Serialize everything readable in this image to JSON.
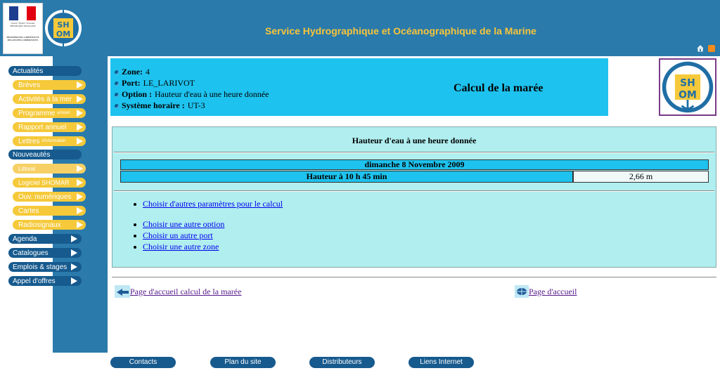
{
  "header": {
    "republique_label": "Liberté • Égalité • Fraternité RÉPUBLIQUE FRANÇAISE",
    "ministry_label": "MINISTÈRE DE LA DÉFENSE ET DES ANCIENS COMBATTANTS",
    "logo_text_top": "SH",
    "logo_text_bottom": "OM",
    "title": "Service Hydrographique et Océanographique de la Marine"
  },
  "nav": {
    "items": [
      {
        "label": "Actualités",
        "type": "main"
      },
      {
        "label": "Brèves",
        "type": "sub"
      },
      {
        "label": "Activités à la mer",
        "type": "sub"
      },
      {
        "label": "Programme",
        "suffix": "annuel",
        "type": "sub"
      },
      {
        "label": "Rapport annuel",
        "type": "sub"
      },
      {
        "label": "Lettres",
        "suffix": "d'information",
        "type": "sub"
      },
      {
        "label": "Nouveautés",
        "type": "main"
      },
      {
        "label": "Littoral",
        "type": "sub"
      },
      {
        "label": "Logiciel SHOMAR",
        "type": "sub"
      },
      {
        "label": "Ouv. numériques",
        "type": "sub"
      },
      {
        "label": "Cartes",
        "type": "sub"
      },
      {
        "label": "Radiosignaux",
        "type": "sub"
      },
      {
        "label": "Agenda",
        "type": "main"
      },
      {
        "label": "Catalogues",
        "type": "main"
      },
      {
        "label": "Emplois & stages",
        "type": "main"
      },
      {
        "label": "Appel d'offres",
        "type": "main"
      }
    ]
  },
  "info": {
    "zone_label": "Zone:",
    "zone_value": "4",
    "port_label": "Port:",
    "port_value": "LE_LARIVOT",
    "option_label": "Option :",
    "option_value": "Hauteur d'eau à une heure donnée",
    "system_label": "Système horaire :",
    "system_value": "UT-3",
    "page_title": "Calcul de la marée"
  },
  "result": {
    "title": "Hauteur d'eau à une heure donnée",
    "date": "dimanche 8 Novembre 2009",
    "height_label": "Hauteur à 10 h 45 min",
    "height_value": "2,66 m",
    "links": [
      "Choisir d'autres paramètres pour le calcul",
      "Choisir une autre option",
      "Choisir un autre port",
      "Choisir une autre zone"
    ]
  },
  "bottom_links": {
    "tide_home": "Page d'accueil calcul de la marée",
    "home": "Page d'accueil"
  },
  "footer": {
    "buttons": [
      "Contacts",
      "Plan du site",
      "Distributeurs",
      "Liens Internet"
    ]
  },
  "colors": {
    "header_blue": "#2a7aab",
    "nav_dark": "#165a8e",
    "nav_yellow": "#f5c93a",
    "panel_cyan": "#1ec2ee",
    "result_bg": "#b0eeef",
    "title_gold": "#f7c53a"
  },
  "icons": [
    "home-icon",
    "rss-icon",
    "back-arrow-icon",
    "globe-icon",
    "bullet-icon",
    "arrow-right-icon"
  ]
}
